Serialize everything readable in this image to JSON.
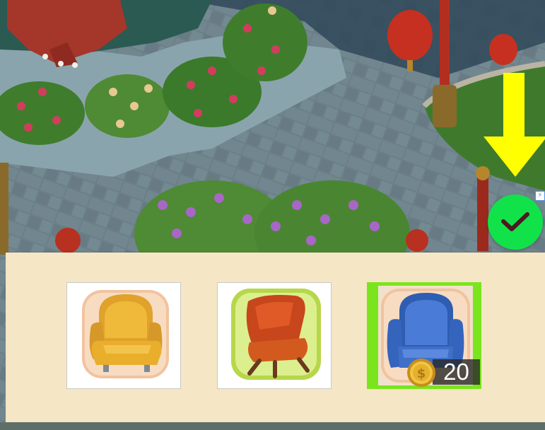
{
  "furniture_picker": {
    "options": [
      {
        "name": "yellow-armchair",
        "color": "#e8ae2c",
        "selected": false
      },
      {
        "name": "orange-lounge-chair",
        "color": "#d35a1e",
        "selected": false
      },
      {
        "name": "blue-armchair",
        "color": "#3f6fc9",
        "selected": true,
        "price": "20",
        "currency_icon": "gold-coin-icon"
      }
    ],
    "confirm_icon": "checkmark-icon",
    "confirm_color": "#12e24a",
    "hint_arrow_color": "#ffff00",
    "ad_badge_icon": "lightning-icon",
    "ad_badge_glyph": "⚡"
  }
}
